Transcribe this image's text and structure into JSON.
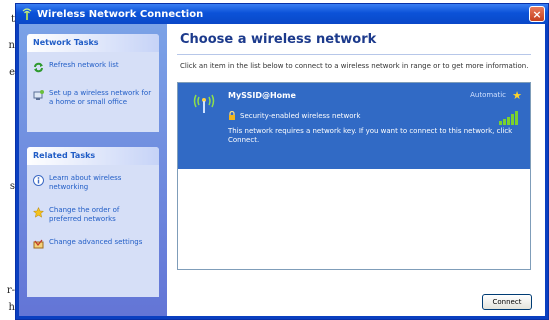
{
  "doc_fragments": [
    {
      "text": "t"
    },
    {
      "text": "n"
    },
    {
      "text": "e"
    },
    {
      "text": "s"
    },
    {
      "text": "r-"
    },
    {
      "text": "h"
    }
  ],
  "window": {
    "title": "Wireless Network Connection",
    "close_glyph": "×"
  },
  "taskpane": {
    "network_tasks": {
      "heading": "Network Tasks",
      "items": [
        {
          "label": "Refresh network list",
          "icon": "refresh-icon"
        },
        {
          "label": "Set up a wireless network for a home or small office",
          "icon": "setup-network-icon"
        }
      ]
    },
    "related_tasks": {
      "heading": "Related Tasks",
      "items": [
        {
          "label": "Learn about wireless networking",
          "icon": "info-icon"
        },
        {
          "label": "Change the order of preferred networks",
          "icon": "star-icon"
        },
        {
          "label": "Change advanced settings",
          "icon": "settings-icon"
        }
      ]
    }
  },
  "content": {
    "heading": "Choose a wireless network",
    "instruction": "Click an item in the list below to connect to a wireless network in range or to get more information.",
    "networks": [
      {
        "name": "MySSID@Home",
        "status": "Automatic",
        "security": "Security-enabled wireless network",
        "description": "This network requires a network key. If you want to connect to this network, click Connect."
      }
    ],
    "connect_label": "Connect"
  },
  "colors": {
    "selection": "#316ac5",
    "titlebar": "#0b52d8",
    "taskpane": "#6f8ce0",
    "link": "#215dc6"
  }
}
